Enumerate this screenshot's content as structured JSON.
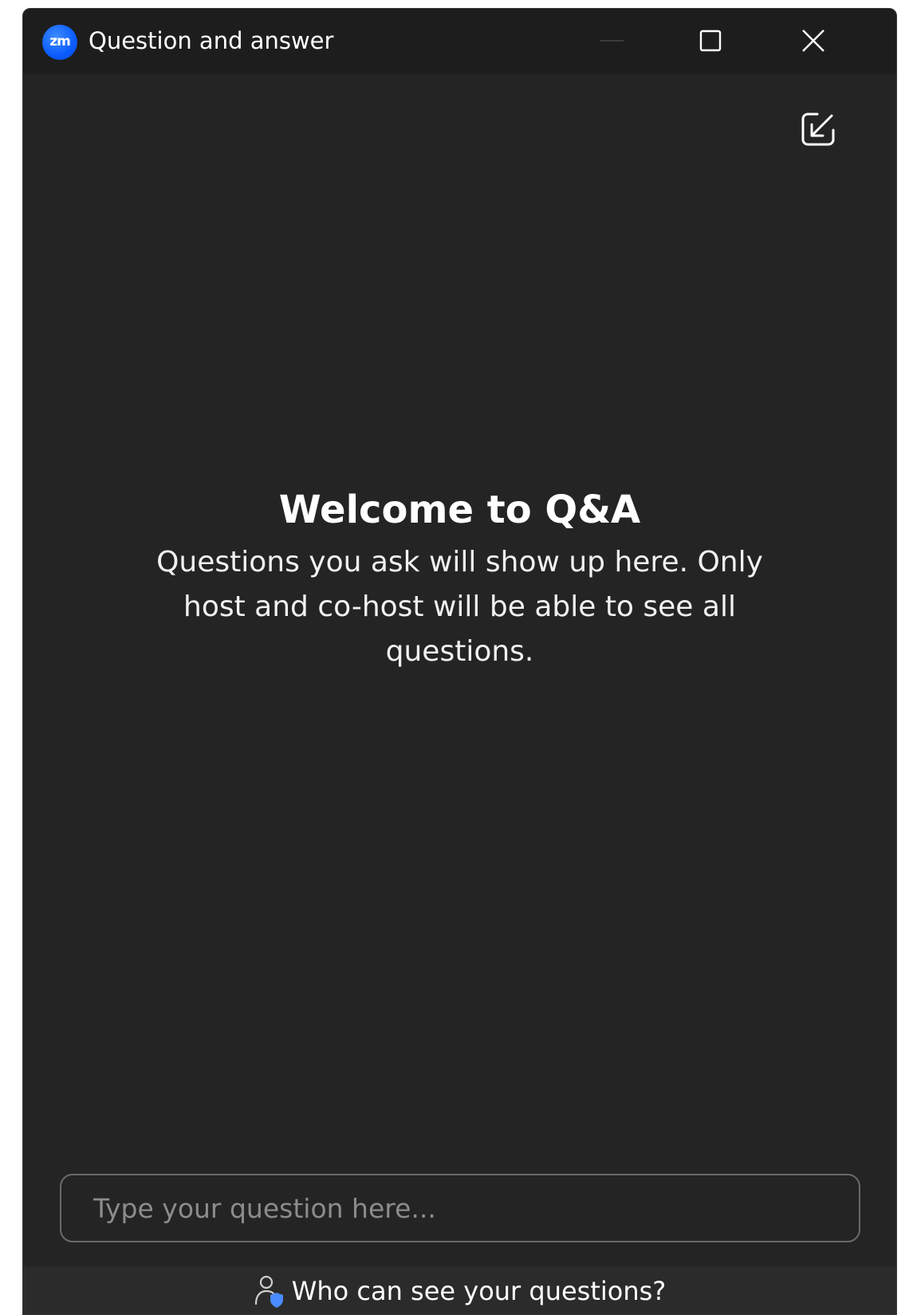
{
  "window": {
    "title": "Question and answer",
    "logo_text": "zm",
    "controls": [
      "minimize-icon",
      "maximize-icon",
      "close-icon"
    ]
  },
  "toolbar": {
    "popin_icon": "pop-in-icon"
  },
  "welcome": {
    "title": "Welcome to Q&A",
    "text": "Questions you ask will show up here. Only host and co-host will be able to see all questions."
  },
  "question_input": {
    "placeholder": "Type your question here...",
    "value": ""
  },
  "footer": {
    "link_label": "Who can see your questions?",
    "icon": "user-shield-icon"
  },
  "colors": {
    "background": "#242424",
    "titlebar": "#1d1d1d",
    "footer": "#2b2b2b",
    "accent": "#0b5cff",
    "text": "#ffffff",
    "placeholder": "#8c8c8c"
  }
}
